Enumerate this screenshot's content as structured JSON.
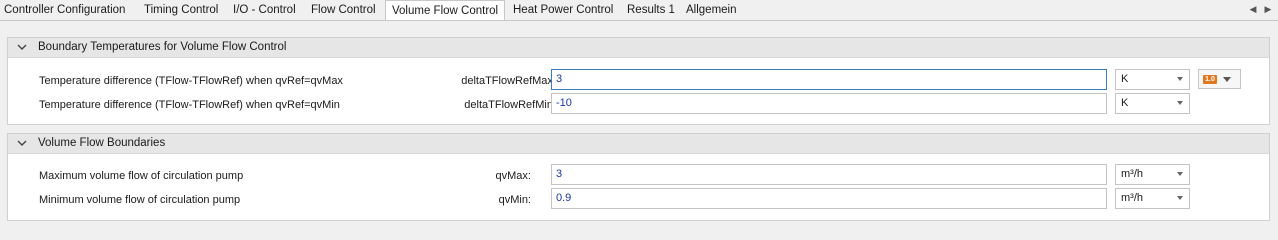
{
  "tabs": [
    {
      "label": "Controller Configuration"
    },
    {
      "label": "Timing Control"
    },
    {
      "label": "I/O - Control"
    },
    {
      "label": "Flow Control"
    },
    {
      "label": "Volume Flow Control",
      "active": true
    },
    {
      "label": "Heat Power Control"
    },
    {
      "label": "Results 1"
    },
    {
      "label": "Allgemein"
    }
  ],
  "tab_scroll": {
    "left": "◀",
    "right": "▶"
  },
  "sections": [
    {
      "title": "Boundary Temperatures for Volume Flow Control",
      "rows": [
        {
          "label": "Temperature difference (TFlow-TFlowRef) when qvRef=qvMax",
          "param": "deltaTFlowRefMax:",
          "value": "3",
          "unit": "K"
        },
        {
          "label": "Temperature difference (TFlow-TFlowRef) when qvRef=qvMin",
          "param": "deltaTFlowRefMin:",
          "value": "-10",
          "unit": "K"
        }
      ]
    },
    {
      "title": "Volume Flow Boundaries",
      "rows": [
        {
          "label": "Maximum volume flow of circulation pump",
          "param": "qvMax:",
          "value": "3",
          "unit": "m³/h"
        },
        {
          "label": "Minimum volume flow of circulation pump",
          "param": "qvMin:",
          "value": "0.9",
          "unit": "m³/h"
        }
      ]
    }
  ],
  "extra_button": {
    "badge": "1.0"
  },
  "colors": {
    "value_text": "#1c36a8",
    "focus_border": "#3b7bbf",
    "badge": "#e07820"
  },
  "icons": [
    "chevron-down-icon",
    "scroll-left-icon",
    "scroll-right-icon",
    "dropdown-arrow-icon"
  ]
}
